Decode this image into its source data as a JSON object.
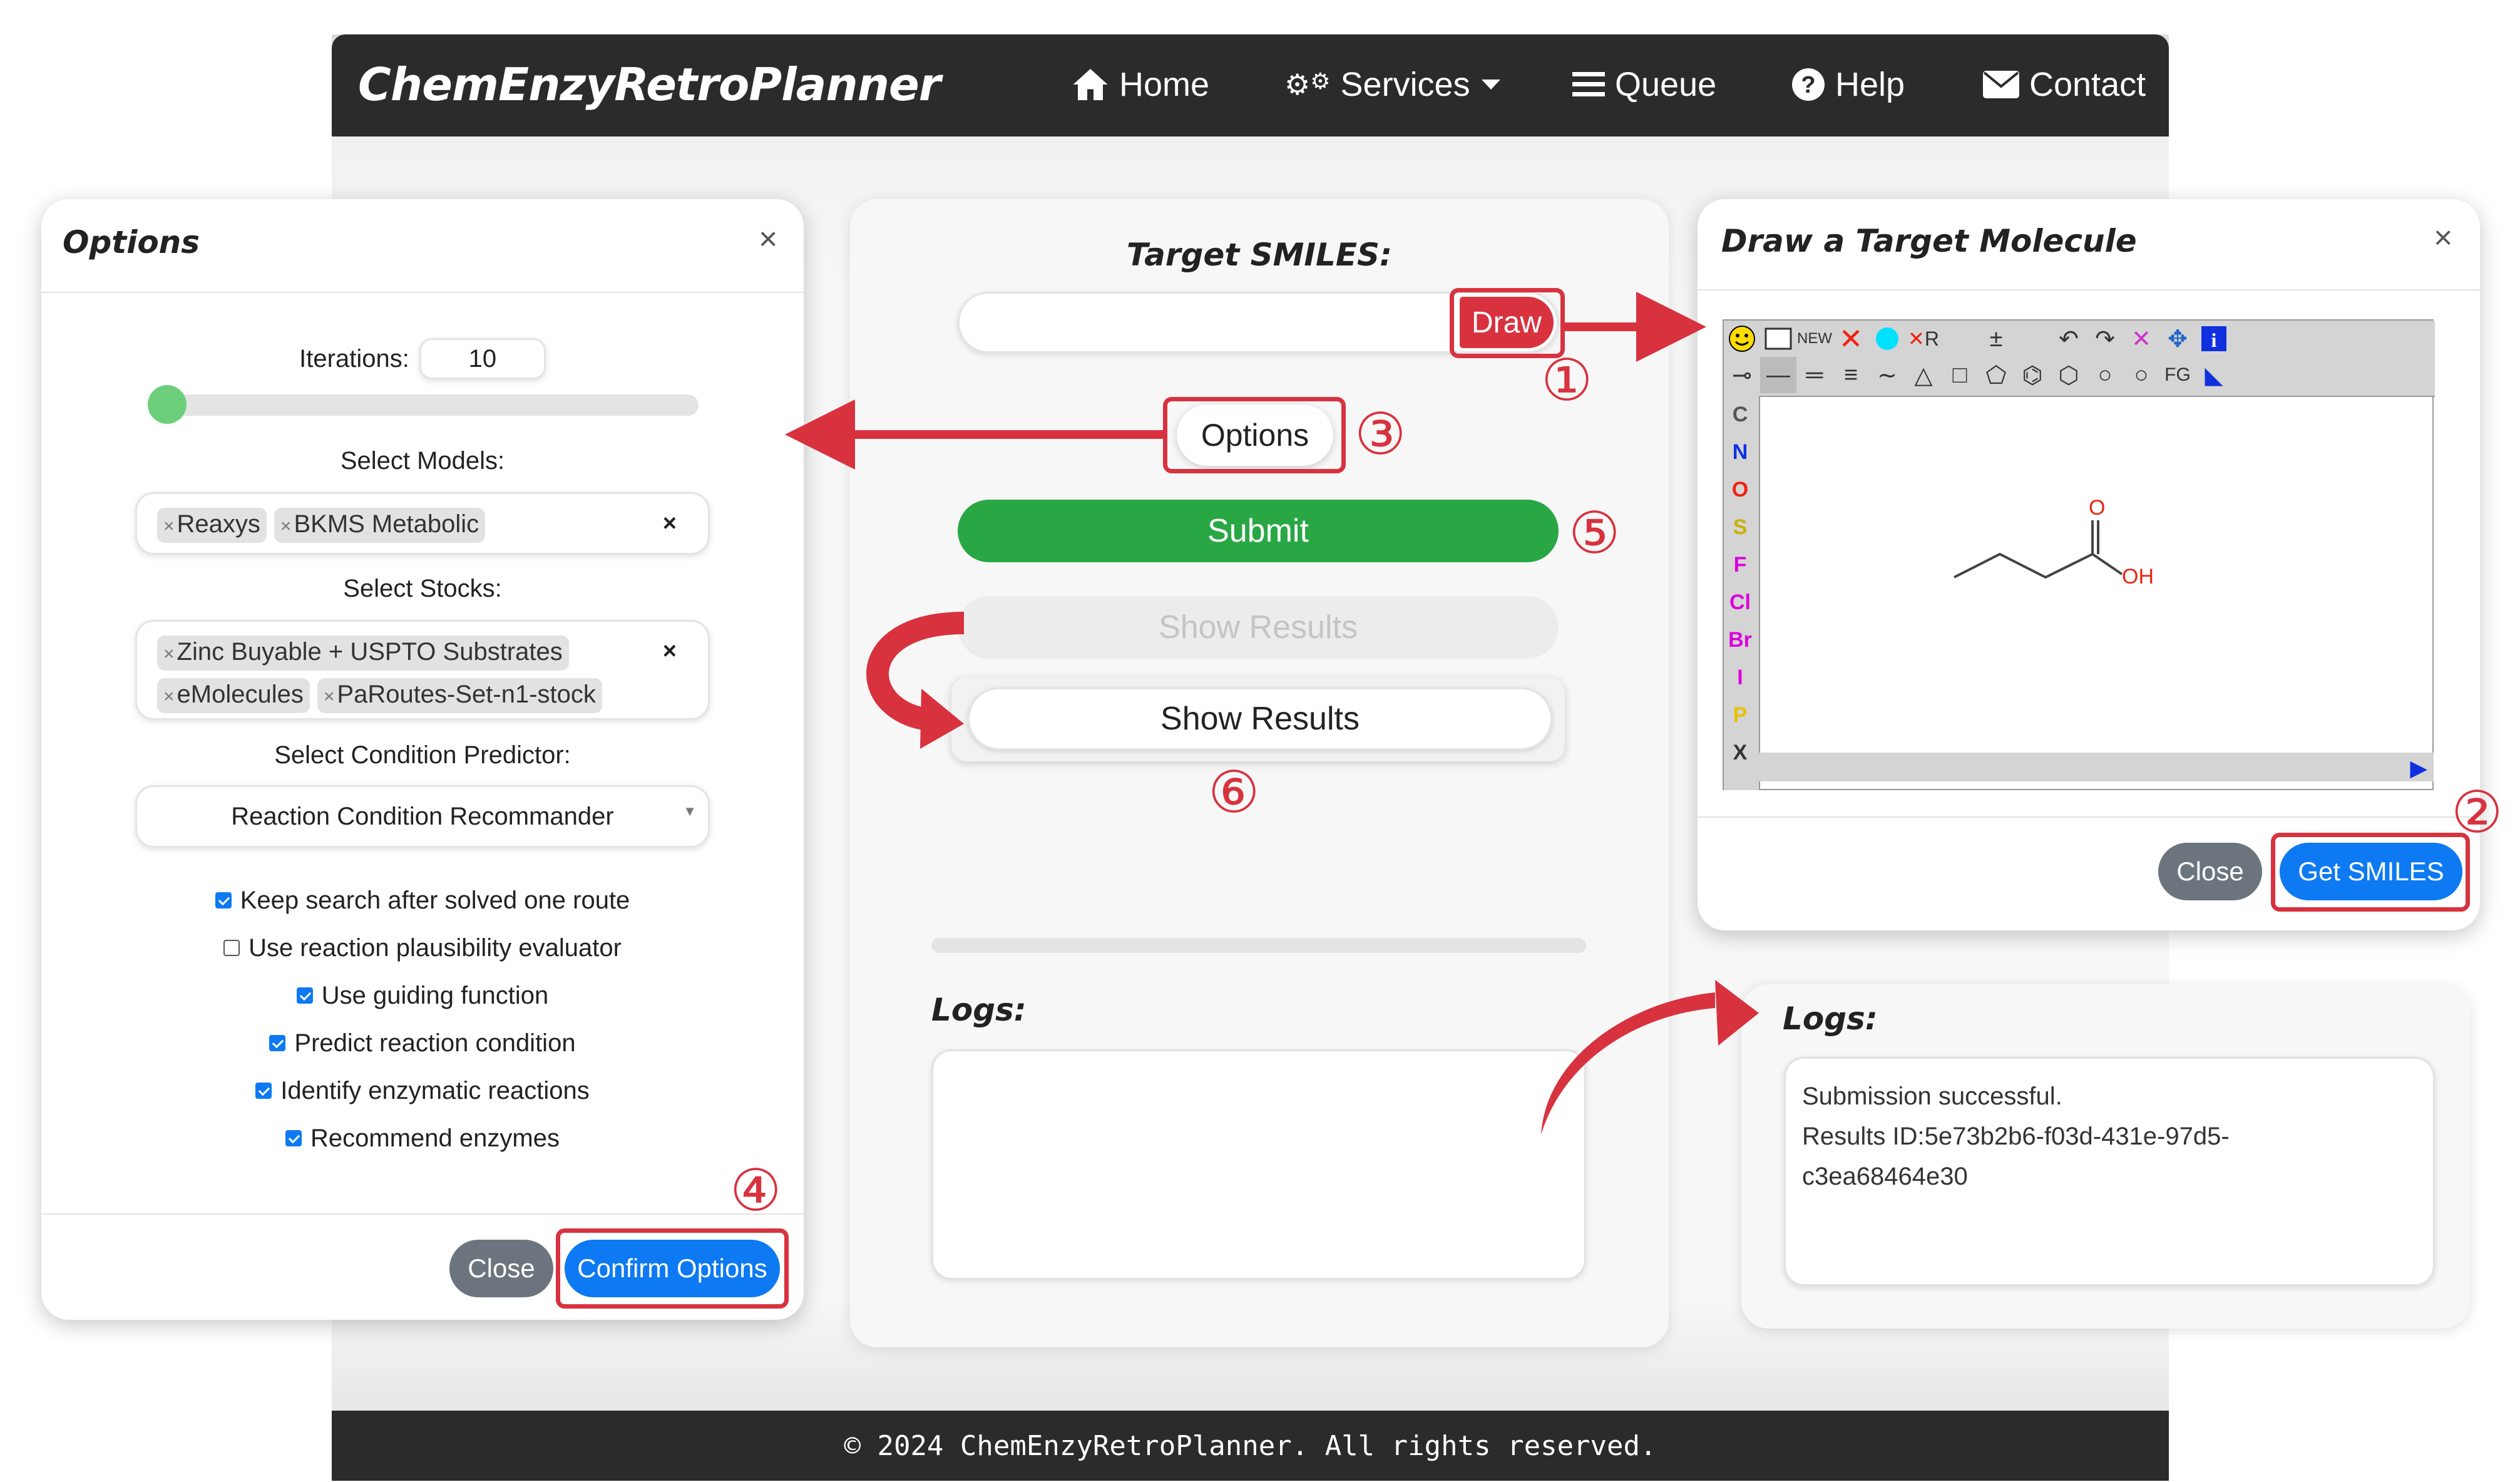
{
  "app": {
    "brand": "ChemEnzyRetroPlanner"
  },
  "nav": {
    "home": {
      "icon": "home-icon",
      "label": "Home"
    },
    "services": {
      "icon": "gears-icon",
      "label": "Services"
    },
    "queue": {
      "icon": "list-icon",
      "label": "Queue"
    },
    "help": {
      "icon": "question-circle-icon",
      "label": "Help"
    },
    "contact": {
      "icon": "envelope-icon",
      "label": "Contact"
    }
  },
  "options_modal": {
    "title": "Options",
    "iterations_label": "Iterations:",
    "iterations_value": "10",
    "iterations_slider_fraction": 0,
    "models_label": "Select Models:",
    "models": [
      "Reaxys",
      "BKMS Metabolic"
    ],
    "stocks_label": "Select Stocks:",
    "stocks": [
      "Zinc Buyable + USPTO Substrates",
      "eMolecules",
      "PaRoutes-Set-n1-stock"
    ],
    "condition_label": "Select Condition Predictor:",
    "condition_value": "Reaction Condition Recommander",
    "checkboxes": [
      {
        "label": "Keep search after solved one route",
        "checked": true
      },
      {
        "label": "Use reaction plausibility evaluator",
        "checked": false
      },
      {
        "label": "Use guiding function",
        "checked": true
      },
      {
        "label": "Predict reaction condition",
        "checked": true
      },
      {
        "label": "Identify enzymatic reactions",
        "checked": true
      },
      {
        "label": "Recommend enzymes",
        "checked": true
      }
    ],
    "close_label": "Close",
    "confirm_label": "Confirm Options"
  },
  "main": {
    "target_label": "Target SMILES:",
    "smiles_value": "",
    "draw_label": "Draw",
    "options_label": "Options",
    "submit_label": "Submit",
    "show_results_disabled": "Show Results",
    "show_results_enabled": "Show Results",
    "logs_label": "Logs:",
    "logs_text": ""
  },
  "draw_modal": {
    "title": "Draw a Target Molecule",
    "toolbar_new": "NEW",
    "toolbar_fg": "FG",
    "atoms": [
      "C",
      "N",
      "O",
      "S",
      "F",
      "Cl",
      "Br",
      "I",
      "P",
      "X"
    ],
    "molecule_labels": {
      "o": "O",
      "oh": "OH"
    },
    "close_label": "Close",
    "get_smiles_label": "Get SMILES"
  },
  "logs_panel": {
    "title": "Logs:",
    "line1": "Submission successful.",
    "line2": "Results ID:5e73b2b6-f03d-431e-97d5-",
    "line3": "c3ea68464e30"
  },
  "steps": [
    "①",
    "②",
    "③",
    "④",
    "⑤",
    "⑥"
  ],
  "footer": {
    "text": "© 2024 ChemEnzyRetroPlanner. All rights reserved."
  },
  "colors": {
    "navbar": "#2b2b2b",
    "accent_red": "#d8323f",
    "submit_green": "#29a745",
    "primary_blue": "#0d79f2",
    "close_gray": "#6c757d"
  }
}
